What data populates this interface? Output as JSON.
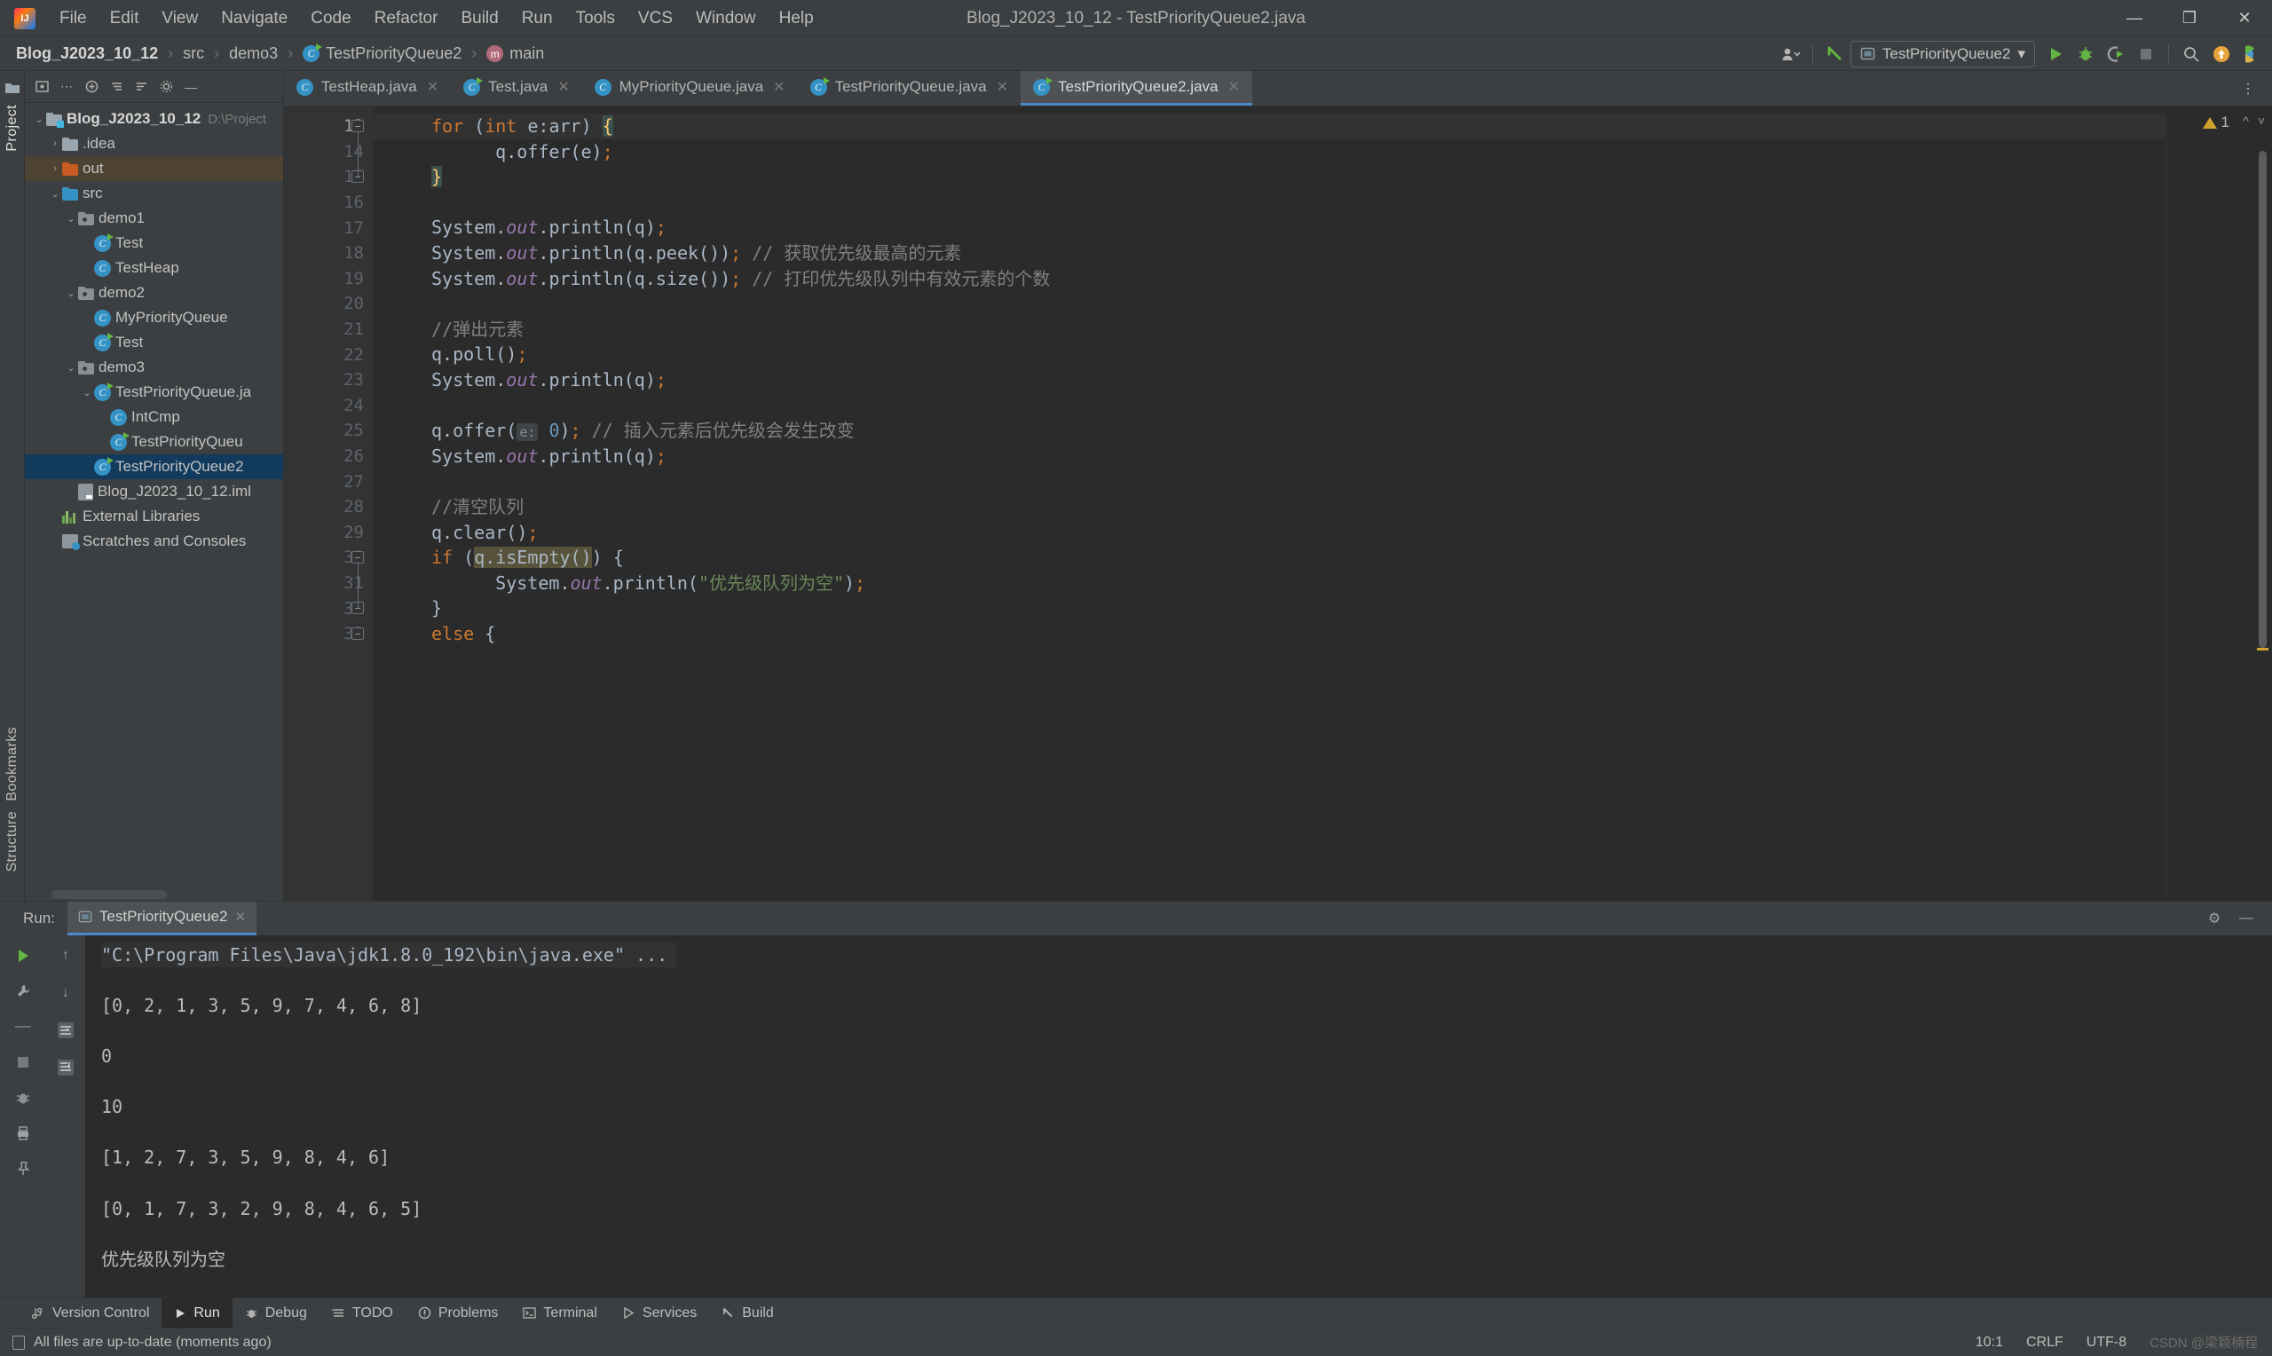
{
  "window": {
    "title": "Blog_J2023_10_12 - TestPriorityQueue2.java",
    "minimize": "—",
    "maximize": "❐",
    "close": "✕"
  },
  "menu": {
    "items": [
      "File",
      "Edit",
      "View",
      "Navigate",
      "Code",
      "Refactor",
      "Build",
      "Run",
      "Tools",
      "VCS",
      "Window",
      "Help"
    ]
  },
  "navbar": {
    "crumbs": [
      {
        "label": "Blog_J2023_10_12",
        "icon": "none",
        "bold": true
      },
      {
        "label": "src",
        "icon": "none",
        "bold": false
      },
      {
        "label": "demo3",
        "icon": "none",
        "bold": false
      },
      {
        "label": "TestPriorityQueue2",
        "icon": "class-icon",
        "bold": false
      },
      {
        "label": "main",
        "icon": "method-icon",
        "bold": false
      }
    ],
    "separator": "›",
    "run_config": "TestPriorityQueue2",
    "dropdown_caret": "▾"
  },
  "project_panel": {
    "title": "Project",
    "tree": [
      {
        "label": "Blog_J2023_10_12",
        "path": "D:\\Project",
        "depth": 0,
        "arrow": "⌄",
        "icon": "project-folder-icon",
        "bold": true,
        "state": "normal"
      },
      {
        "label": ".idea",
        "path": "",
        "depth": 1,
        "arrow": "›",
        "icon": "folder-icon",
        "bold": false,
        "state": "normal"
      },
      {
        "label": "out",
        "path": "",
        "depth": 1,
        "arrow": "›",
        "icon": "folder-orange-icon",
        "bold": false,
        "state": "highlight"
      },
      {
        "label": "src",
        "path": "",
        "depth": 1,
        "arrow": "⌄",
        "icon": "folder-source-icon",
        "bold": false,
        "state": "normal"
      },
      {
        "label": "demo1",
        "path": "",
        "depth": 2,
        "arrow": "⌄",
        "icon": "package-icon",
        "bold": false,
        "state": "normal"
      },
      {
        "label": "Test",
        "path": "",
        "depth": 3,
        "arrow": "",
        "icon": "class-runnable-icon",
        "bold": false,
        "state": "normal"
      },
      {
        "label": "TestHeap",
        "path": "",
        "depth": 3,
        "arrow": "",
        "icon": "class-icon",
        "bold": false,
        "state": "normal"
      },
      {
        "label": "demo2",
        "path": "",
        "depth": 2,
        "arrow": "⌄",
        "icon": "package-icon",
        "bold": false,
        "state": "normal"
      },
      {
        "label": "MyPriorityQueue",
        "path": "",
        "depth": 3,
        "arrow": "",
        "icon": "class-icon",
        "bold": false,
        "state": "normal"
      },
      {
        "label": "Test",
        "path": "",
        "depth": 3,
        "arrow": "",
        "icon": "class-runnable-icon",
        "bold": false,
        "state": "normal"
      },
      {
        "label": "demo3",
        "path": "",
        "depth": 2,
        "arrow": "⌄",
        "icon": "package-icon",
        "bold": false,
        "state": "normal"
      },
      {
        "label": "TestPriorityQueue.ja",
        "path": "",
        "depth": 3,
        "arrow": "⌄",
        "icon": "class-runnable-icon",
        "bold": false,
        "state": "normal"
      },
      {
        "label": "IntCmp",
        "path": "",
        "depth": 4,
        "arrow": "",
        "icon": "class-icon",
        "bold": false,
        "state": "normal"
      },
      {
        "label": "TestPriorityQueu",
        "path": "",
        "depth": 4,
        "arrow": "",
        "icon": "class-runnable-icon",
        "bold": false,
        "state": "normal"
      },
      {
        "label": "TestPriorityQueue2",
        "path": "",
        "depth": 3,
        "arrow": "",
        "icon": "class-runnable-icon",
        "bold": false,
        "state": "selected"
      },
      {
        "label": "Blog_J2023_10_12.iml",
        "path": "",
        "depth": 2,
        "arrow": "",
        "icon": "iml-icon",
        "bold": false,
        "state": "normal"
      },
      {
        "label": "External Libraries",
        "path": "",
        "depth": 1,
        "arrow": "",
        "icon": "library-icon",
        "bold": false,
        "state": "normal"
      },
      {
        "label": "Scratches and Consoles",
        "path": "",
        "depth": 1,
        "arrow": "",
        "icon": "scratches-icon",
        "bold": false,
        "state": "normal"
      }
    ]
  },
  "left_strip": {
    "project_label": "Project",
    "bookmarks_label": "Bookmarks",
    "structure_label": "Structure"
  },
  "editor": {
    "tabs": [
      {
        "label": "TestHeap.java",
        "icon": "class-icon",
        "active": false
      },
      {
        "label": "Test.java",
        "icon": "class-runnable-icon",
        "active": false
      },
      {
        "label": "MyPriorityQueue.java",
        "icon": "class-icon",
        "active": false
      },
      {
        "label": "TestPriorityQueue.java",
        "icon": "class-runnable-icon",
        "active": false
      },
      {
        "label": "TestPriorityQueue2.java",
        "icon": "class-runnable-icon",
        "active": true
      }
    ],
    "close_glyph": "✕",
    "warning_count": "1",
    "first_line": 13,
    "lines": [
      {
        "n": 13,
        "current": true,
        "fold": "collapse",
        "html": "<span class=\"kw\">for</span> (<span class=\"kw\">int</span> e:arr) <span class=\"brace-hl\">{</span>",
        "indent": 2
      },
      {
        "n": 14,
        "current": false,
        "fold": "",
        "html": "    q.offer(e)<span class=\"kw\">;</span>",
        "indent": 3
      },
      {
        "n": 15,
        "current": false,
        "fold": "end",
        "html": "<span class=\"brace-hl\">}</span>",
        "indent": 2
      },
      {
        "n": 16,
        "current": false,
        "fold": "",
        "html": "",
        "indent": 0
      },
      {
        "n": 17,
        "current": false,
        "fold": "",
        "html": "System.<span class=\"fld\">out</span>.println(q)<span class=\"kw\">;</span>",
        "indent": 2
      },
      {
        "n": 18,
        "current": false,
        "fold": "",
        "html": "System.<span class=\"fld\">out</span>.println(q.peek())<span class=\"kw\">;</span> <span class=\"cmt\">// 获取优先级最高的元素</span>",
        "indent": 2
      },
      {
        "n": 19,
        "current": false,
        "fold": "",
        "html": "System.<span class=\"fld\">out</span>.println(q.size())<span class=\"kw\">;</span> <span class=\"cmt\">// 打印优先级队列中有效元素的个数</span>",
        "indent": 2
      },
      {
        "n": 20,
        "current": false,
        "fold": "",
        "html": "",
        "indent": 0
      },
      {
        "n": 21,
        "current": false,
        "fold": "",
        "html": "<span class=\"cmt\">//弹出元素</span>",
        "indent": 2
      },
      {
        "n": 22,
        "current": false,
        "fold": "",
        "html": "q.poll()<span class=\"kw\">;</span>",
        "indent": 2
      },
      {
        "n": 23,
        "current": false,
        "fold": "",
        "html": "System.<span class=\"fld\">out</span>.println(q)<span class=\"kw\">;</span>",
        "indent": 2
      },
      {
        "n": 24,
        "current": false,
        "fold": "",
        "html": "",
        "indent": 0
      },
      {
        "n": 25,
        "current": false,
        "fold": "",
        "html": "q.offer(<span class=\"hint\">e:</span> <span class=\"num\">0</span>)<span class=\"kw\">;</span> <span class=\"cmt\">// 插入元素后优先级会发生改变</span>",
        "indent": 2
      },
      {
        "n": 26,
        "current": false,
        "fold": "",
        "html": "System.<span class=\"fld\">out</span>.println(q)<span class=\"kw\">;</span>",
        "indent": 2
      },
      {
        "n": 27,
        "current": false,
        "fold": "",
        "html": "",
        "indent": 0
      },
      {
        "n": 28,
        "current": false,
        "fold": "",
        "html": "<span class=\"cmt\">//清空队列</span>",
        "indent": 2
      },
      {
        "n": 29,
        "current": false,
        "fold": "",
        "html": "q.clear()<span class=\"kw\">;</span>",
        "indent": 2
      },
      {
        "n": 30,
        "current": false,
        "fold": "collapse",
        "html": "<span class=\"kw\">if</span> (<span class=\"hlbox\">q.isEmpty()</span>) {",
        "indent": 2
      },
      {
        "n": 31,
        "current": false,
        "fold": "",
        "html": "    System.<span class=\"fld\">out</span>.println(<span class=\"str\">\"优先级队列为空\"</span>)<span class=\"kw\">;</span>",
        "indent": 3
      },
      {
        "n": 32,
        "current": false,
        "fold": "end",
        "html": "}",
        "indent": 2
      },
      {
        "n": 33,
        "current": false,
        "fold": "collapse",
        "html": "<span class=\"kw\">else</span> {",
        "indent": 2
      }
    ]
  },
  "run_panel": {
    "label": "Run:",
    "tab_title": "TestPriorityQueue2",
    "close_glyph": "✕",
    "output": [
      {
        "text": "\"C:\\Program Files\\Java\\jdk1.8.0_192\\bin\\java.exe\" ...",
        "kind": "command"
      },
      {
        "text": "[0, 2, 1, 3, 5, 9, 7, 4, 6, 8]",
        "kind": "out"
      },
      {
        "text": "0",
        "kind": "out"
      },
      {
        "text": "10",
        "kind": "out"
      },
      {
        "text": "[1, 2, 7, 3, 5, 9, 8, 4, 6]",
        "kind": "out"
      },
      {
        "text": "[0, 1, 7, 3, 2, 9, 8, 4, 6, 5]",
        "kind": "out"
      },
      {
        "text": "优先级队列为空",
        "kind": "out"
      }
    ],
    "settings_glyph": "⚙",
    "hide_glyph": "—"
  },
  "toolwindow_bar": {
    "items": [
      {
        "label": "Version Control",
        "icon": "vcs-icon",
        "active": false
      },
      {
        "label": "Run",
        "icon": "run-icon",
        "active": true
      },
      {
        "label": "Debug",
        "icon": "debug-icon",
        "active": false
      },
      {
        "label": "TODO",
        "icon": "todo-icon",
        "active": false
      },
      {
        "label": "Problems",
        "icon": "problems-icon",
        "active": false
      },
      {
        "label": "Terminal",
        "icon": "terminal-icon",
        "active": false
      },
      {
        "label": "Services",
        "icon": "services-icon",
        "active": false
      },
      {
        "label": "Build",
        "icon": "build-icon",
        "active": false
      }
    ]
  },
  "statusbar": {
    "message": "All files are up-to-date (moments ago)",
    "caret": "10:1",
    "line_sep": "CRLF",
    "encoding": "UTF-8",
    "watermark": "CSDN @梁颖楠程"
  },
  "colors": {
    "accent": "#4a88c7",
    "selection": "#113a5c",
    "highlight_row": "#4e4232",
    "green": "#62b543",
    "warning": "#d0a32c",
    "panel_bg": "#3c3f41",
    "editor_bg": "#2b2b2b"
  }
}
